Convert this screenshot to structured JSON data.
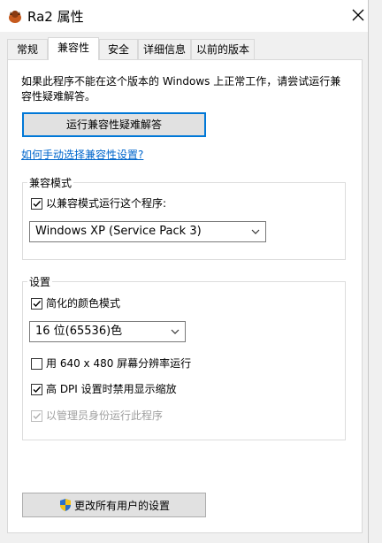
{
  "window": {
    "title": "Ra2 属性",
    "close_icon": "close-icon",
    "app_icon": "ra2-app-icon"
  },
  "tabs": [
    {
      "label": "常规",
      "active": false
    },
    {
      "label": "兼容性",
      "active": true
    },
    {
      "label": "安全",
      "active": false
    },
    {
      "label": "详细信息",
      "active": false
    },
    {
      "label": "以前的版本",
      "active": false
    }
  ],
  "intro": {
    "line1": "如果此程序不能在这个版本的 Windows 上正常工作，请尝试运行兼",
    "line2": "容性疑难解答。"
  },
  "troubleshoot_button": "运行兼容性疑难解答",
  "manual_link": "如何手动选择兼容性设置?",
  "compat_group": {
    "title": "兼容模式",
    "checkbox_label": "以兼容模式运行这个程序:",
    "checked": true,
    "selected_os": "Windows XP (Service Pack 3)"
  },
  "settings_group": {
    "title": "设置",
    "reduced_color": {
      "label": "简化的颜色模式",
      "checked": true
    },
    "color_select": "16 位(65536)色",
    "res_640": {
      "label": "用 640 x 480 屏幕分辨率运行",
      "checked": false
    },
    "high_dpi": {
      "label": "高 DPI 设置时禁用显示缩放",
      "checked": true
    },
    "run_admin": {
      "label": "以管理员身份运行此程序",
      "checked": true,
      "disabled": true
    }
  },
  "all_users_button": "更改所有用户的设置",
  "colors": {
    "accent": "#0078d7",
    "link": "#0066cc",
    "button_bg": "#e1e1e1",
    "dialog_bg": "#f0f0f0"
  }
}
